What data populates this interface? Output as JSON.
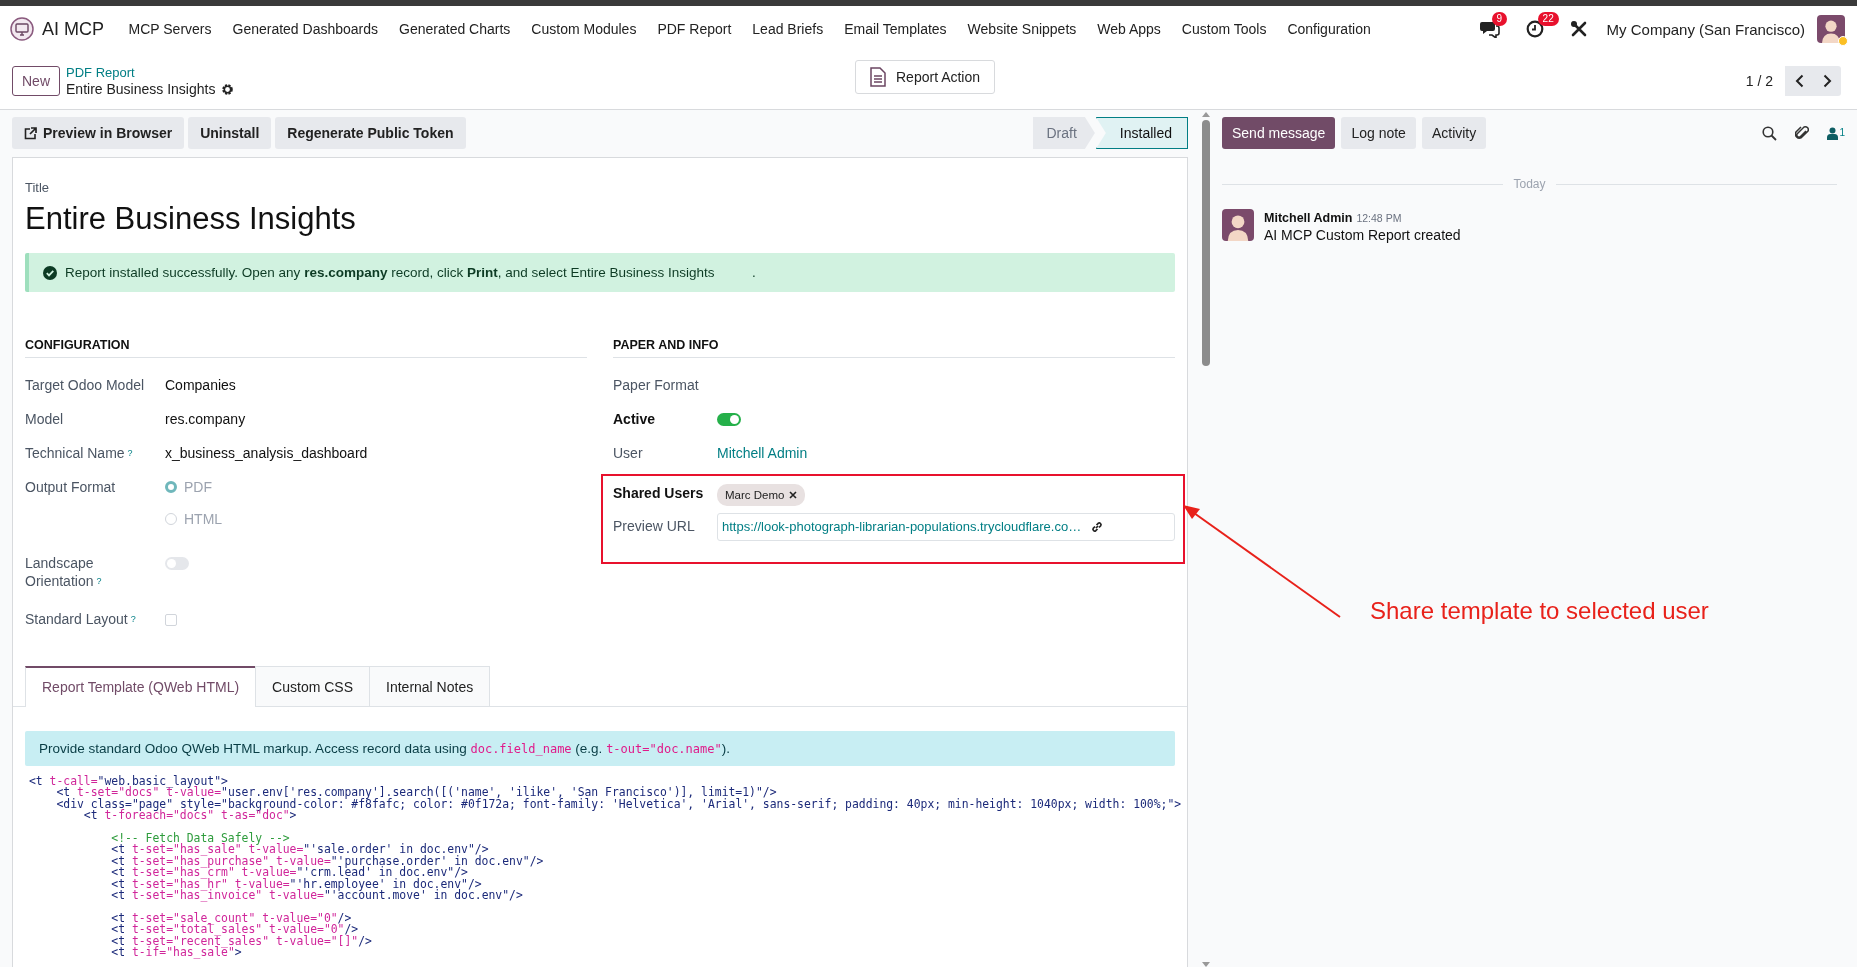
{
  "navbar": {
    "app_name": "AI MCP",
    "menu": [
      "MCP Servers",
      "Generated Dashboards",
      "Generated Charts",
      "Custom Modules",
      "PDF Report",
      "Lead Briefs",
      "Email Templates",
      "Website Snippets",
      "Web Apps",
      "Custom Tools",
      "Configuration"
    ],
    "messages_badge": "9",
    "activities_badge": "22",
    "company": "My Company (San Francisco)"
  },
  "control_panel": {
    "new_button": "New",
    "breadcrumb": "PDF Report",
    "record_name": "Entire Business Insights",
    "action_button": "Report Action",
    "pager": "1 / 2"
  },
  "action_buttons": [
    {
      "label": "Preview in Browser",
      "has_icon": true
    },
    {
      "label": "Uninstall",
      "has_icon": false
    },
    {
      "label": "Regenerate Public Token",
      "has_icon": false
    }
  ],
  "statusbar": [
    {
      "label": "Draft",
      "selected": false
    },
    {
      "label": "Installed",
      "selected": true
    }
  ],
  "form": {
    "title_label": "Title",
    "title": "Entire Business Insights",
    "alert": "Report installed successfully. Open any **res.company** record, click **Print**, and select Entire Business Insights          .",
    "sections": [
      {
        "heading": "CONFIGURATION",
        "fields": [
          {
            "kind": "text",
            "label": "Target Odoo Model",
            "required": false,
            "highlighted": false,
            "value": "Companies"
          },
          {
            "kind": "text",
            "label": "Model",
            "required": false,
            "highlighted": false,
            "value": "res.company"
          },
          {
            "kind": "text",
            "label": "Technical Name",
            "help": "?",
            "required": false,
            "highlighted": false,
            "value": "x_business_analysis_dashboard"
          },
          {
            "kind": "radio",
            "label": "Output Format",
            "required": false,
            "highlighted": false,
            "options": [
              {
                "label": "PDF",
                "selected": true
              },
              {
                "label": "HTML",
                "selected": false
              }
            ]
          },
          {
            "kind": "toggle",
            "label": "Landscape Orientation",
            "help": "?",
            "required": false,
            "highlighted": false,
            "on": false
          },
          {
            "kind": "checkbox",
            "label": "Standard Layout",
            "help": "?",
            "required": false,
            "highlighted": false,
            "checked": false
          }
        ]
      },
      {
        "heading": "PAPER AND INFO",
        "fields": [
          {
            "kind": "text",
            "label": "Paper Format",
            "required": false,
            "highlighted": false
          },
          {
            "kind": "toggle",
            "label": "Active",
            "required": true,
            "highlighted": false,
            "on": true
          },
          {
            "kind": "link",
            "label": "User",
            "required": false,
            "highlighted": false,
            "value": "Mitchell Admin"
          },
          {
            "kind": "tags",
            "label": "Shared Users",
            "required": true,
            "highlighted": true,
            "tags": [
              "Marc Demo"
            ]
          },
          {
            "kind": "url",
            "label": "Preview URL",
            "required": false,
            "highlighted": true,
            "value": "https://look-photograph-librarian-populations.trycloudflare.co…"
          }
        ]
      }
    ]
  },
  "tabs": [
    {
      "label": "Report Template (QWeb HTML)",
      "selected": true
    },
    {
      "label": "Custom CSS",
      "selected": false
    },
    {
      "label": "Internal Notes",
      "selected": false
    }
  ],
  "info": [
    {
      "kind": "text",
      "text": "Provide standard Odoo QWeb HTML markup. Access record data using "
    },
    {
      "kind": "code",
      "text": "doc.field_name"
    },
    {
      "kind": "text",
      "text": " (e.g. "
    },
    {
      "kind": "code",
      "text": "t-out=\"doc.name\""
    },
    {
      "kind": "text",
      "text": ")."
    }
  ],
  "code": [
    {
      "gap_before": false,
      "tokens": [
        {
          "kind": "tag",
          "text": "<t "
        },
        {
          "kind": "name",
          "text": "t-call="
        },
        {
          "kind": "value",
          "text": "\"web.basic_layout\""
        },
        {
          "kind": "tag",
          "text": ">"
        }
      ]
    },
    {
      "gap_before": false,
      "tokens": [
        {
          "kind": "tag",
          "text": "    <t "
        },
        {
          "kind": "name",
          "text": "t-set=\"docs\" t-value="
        },
        {
          "kind": "value",
          "text": "\"user.env['res.company'].search([('name', 'ilike', 'San Francisco')], limit=1)\""
        },
        {
          "kind": "tag",
          "text": "/>"
        }
      ]
    },
    {
      "gap_before": false,
      "tokens": [
        {
          "kind": "tag",
          "text": "    <div class="
        },
        {
          "kind": "value",
          "text": "\"page\""
        },
        {
          "kind": "tag",
          "text": " style="
        },
        {
          "kind": "value",
          "text": "\"background-color: #f8fafc; color: #0f172a; font-family: 'Helvetica', 'Arial', sans-serif; padding: 40px; min-height: 1040px; width: 100%;\""
        },
        {
          "kind": "tag",
          "text": ">"
        }
      ]
    },
    {
      "gap_before": false,
      "tokens": [
        {
          "kind": "tag",
          "text": "        <t "
        },
        {
          "kind": "name",
          "text": "t-foreach=\"docs\" t-as=\"doc\""
        },
        {
          "kind": "tag",
          "text": ">"
        }
      ]
    },
    {
      "gap_before": true,
      "tokens": [
        {
          "kind": "comment",
          "text": "            <!-- Fetch Data Safely -->"
        }
      ]
    },
    {
      "gap_before": false,
      "tokens": [
        {
          "kind": "tag",
          "text": "            <t "
        },
        {
          "kind": "name",
          "text": "t-set=\"has_sale\" t-value="
        },
        {
          "kind": "value",
          "text": "\"'sale.order' in doc.env\""
        },
        {
          "kind": "tag",
          "text": "/>"
        }
      ]
    },
    {
      "gap_before": false,
      "tokens": [
        {
          "kind": "tag",
          "text": "            <t "
        },
        {
          "kind": "name",
          "text": "t-set=\"has_purchase\" t-value="
        },
        {
          "kind": "value",
          "text": "\"'purchase.order' in doc.env\""
        },
        {
          "kind": "tag",
          "text": "/>"
        }
      ]
    },
    {
      "gap_before": false,
      "tokens": [
        {
          "kind": "tag",
          "text": "            <t "
        },
        {
          "kind": "name",
          "text": "t-set=\"has_crm\" t-value="
        },
        {
          "kind": "value",
          "text": "\"'crm.lead' in doc.env\""
        },
        {
          "kind": "tag",
          "text": "/>"
        }
      ]
    },
    {
      "gap_before": false,
      "tokens": [
        {
          "kind": "tag",
          "text": "            <t "
        },
        {
          "kind": "name",
          "text": "t-set=\"has_hr\" t-value="
        },
        {
          "kind": "value",
          "text": "\"'hr.employee' in doc.env\""
        },
        {
          "kind": "tag",
          "text": "/>"
        }
      ]
    },
    {
      "gap_before": false,
      "tokens": [
        {
          "kind": "tag",
          "text": "            <t "
        },
        {
          "kind": "name",
          "text": "t-set=\"has_invoice\" t-value="
        },
        {
          "kind": "value",
          "text": "\"'account.move' in doc.env\""
        },
        {
          "kind": "tag",
          "text": "/>"
        }
      ]
    },
    {
      "gap_before": true,
      "tokens": [
        {
          "kind": "tag",
          "text": "            <t "
        },
        {
          "kind": "name",
          "text": "t-set=\"sale_count\" t-value=\"0\""
        },
        {
          "kind": "tag",
          "text": "/>"
        }
      ]
    },
    {
      "gap_before": false,
      "tokens": [
        {
          "kind": "tag",
          "text": "            <t "
        },
        {
          "kind": "name",
          "text": "t-set=\"total_sales\" t-value=\"0\""
        },
        {
          "kind": "tag",
          "text": "/>"
        }
      ]
    },
    {
      "gap_before": false,
      "tokens": [
        {
          "kind": "tag",
          "text": "            <t "
        },
        {
          "kind": "name",
          "text": "t-set=\"recent_sales\" t-value=\"[]\""
        },
        {
          "kind": "tag",
          "text": "/>"
        }
      ]
    },
    {
      "gap_before": false,
      "tokens": [
        {
          "kind": "tag",
          "text": "            <t "
        },
        {
          "kind": "name",
          "text": "t-if=\"has_sale\""
        },
        {
          "kind": "tag",
          "text": ">"
        }
      ]
    }
  ],
  "chatter": {
    "buttons": [
      {
        "label": "Send message",
        "primary": true
      },
      {
        "label": "Log note",
        "primary": false
      },
      {
        "label": "Activity",
        "primary": false
      }
    ],
    "followers": "1",
    "day": "Today",
    "messages": [
      {
        "author": "Mitchell Admin",
        "time": "12:48 PM",
        "body": "AI MCP Custom Report created"
      }
    ]
  },
  "annotation": {
    "text": "Share template to selected user"
  }
}
